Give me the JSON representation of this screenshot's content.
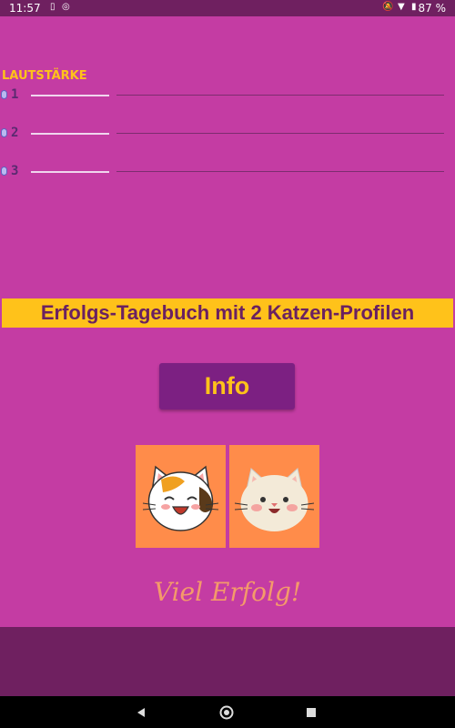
{
  "status_bar": {
    "time": "11:57",
    "battery": "87 %",
    "icons": [
      "sim-card-icon",
      "notification-badge-icon",
      "mute-icon",
      "wifi-icon",
      "battery-icon"
    ]
  },
  "volume": {
    "title": "LAUTSTÄRKE",
    "sliders": [
      {
        "label": "1",
        "level": 0.2
      },
      {
        "label": "2",
        "level": 0.2
      },
      {
        "label": "3",
        "level": 0.2
      }
    ]
  },
  "banner": {
    "text": "Erfolgs-Tagebuch mit 2 Katzen-Profilen"
  },
  "info_button": {
    "label": "Info"
  },
  "profiles": [
    {
      "icon": "calico-cat-face-icon"
    },
    {
      "icon": "white-cat-face-icon"
    }
  ],
  "wish": {
    "text": "Viel Erfolg!"
  },
  "colors": {
    "background": "#c43ca3",
    "accent": "#ffc21a",
    "button": "#7c2082",
    "panel": "#6f2060",
    "card": "#ff8c4a"
  },
  "nav_bar": {
    "icons": [
      "back-icon",
      "home-icon",
      "recents-icon"
    ]
  }
}
